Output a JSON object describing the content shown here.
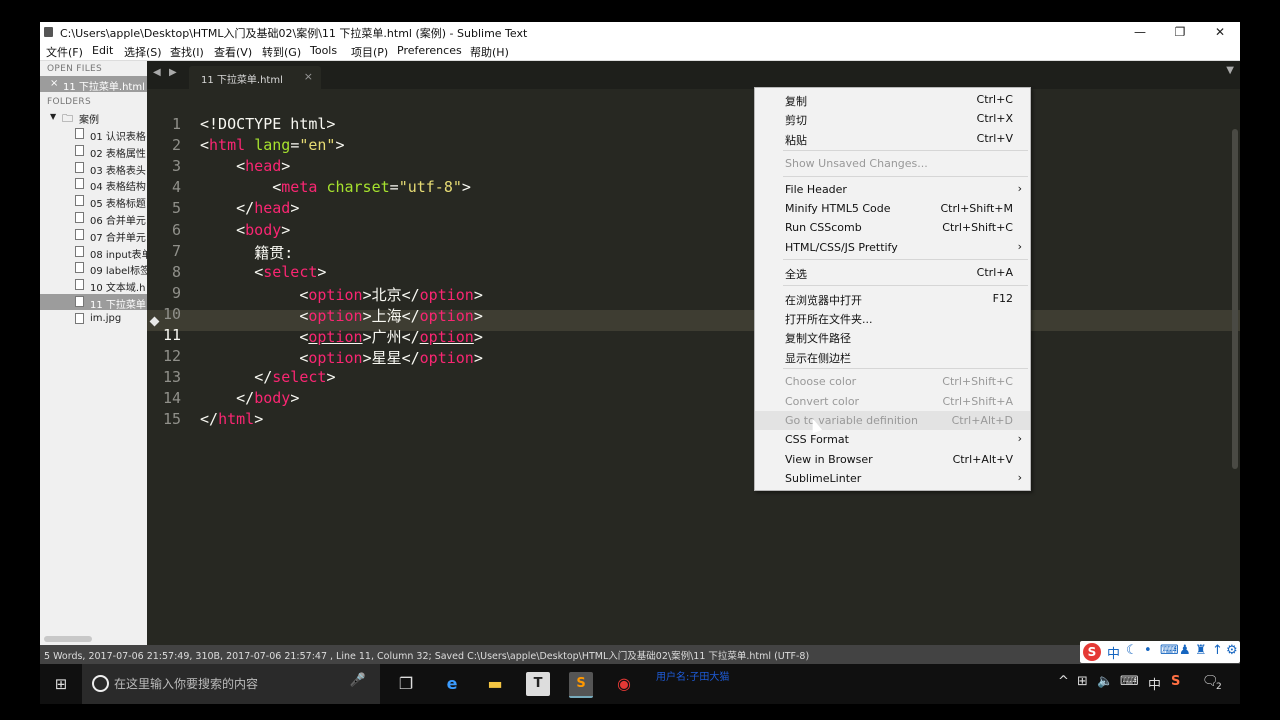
{
  "window": {
    "title": "C:\\Users\\apple\\Desktop\\HTML入门及基础02\\案例\\11 下拉菜单.html (案例) - Sublime Text",
    "controls": {
      "minimize": "—",
      "restore": "❐",
      "close": "✕"
    }
  },
  "menu": [
    "文件(F)",
    "Edit",
    "选择(S)",
    "查找(I)",
    "查看(V)",
    "转到(G)",
    "Tools",
    "项目(P)",
    "Preferences",
    "帮助(H)"
  ],
  "sidebar": {
    "open_files_label": "OPEN FILES",
    "open_file": "11 下拉菜单.html",
    "close_glyph": "×",
    "folders_label": "FOLDERS",
    "folder": "案例",
    "files": [
      "01 认识表格",
      "02 表格属性",
      "03 表格表头",
      "04 表格结构",
      "05 表格标题",
      "06 合并单元",
      "07 合并单元",
      "08 input表单",
      "09 label标签",
      "10 文本域.h",
      "11 下拉菜单",
      "im.jpg"
    ],
    "selected_index": 10
  },
  "tabs": [
    {
      "label": "11 下拉菜单.html",
      "close": "×"
    }
  ],
  "editor": {
    "active_line": 11,
    "lines": [
      {
        "n": "1",
        "indent": "",
        "parts": [
          {
            "t": "<!DOCTYPE html>",
            "c": ""
          }
        ]
      },
      {
        "n": "2",
        "indent": "",
        "parts": [
          {
            "t": "<",
            "c": ""
          },
          {
            "t": "html",
            "c": "tg"
          },
          {
            "t": " ",
            "c": ""
          },
          {
            "t": "lang",
            "c": "at"
          },
          {
            "t": "=",
            "c": ""
          },
          {
            "t": "\"en\"",
            "c": "st"
          },
          {
            "t": ">",
            "c": ""
          }
        ]
      },
      {
        "n": "3",
        "indent": "    ",
        "parts": [
          {
            "t": "<",
            "c": ""
          },
          {
            "t": "head",
            "c": "tg"
          },
          {
            "t": ">",
            "c": ""
          }
        ]
      },
      {
        "n": "4",
        "indent": "        ",
        "parts": [
          {
            "t": "<",
            "c": ""
          },
          {
            "t": "meta",
            "c": "tg"
          },
          {
            "t": " ",
            "c": ""
          },
          {
            "t": "charset",
            "c": "at"
          },
          {
            "t": "=",
            "c": ""
          },
          {
            "t": "\"utf-8\"",
            "c": "st"
          },
          {
            "t": ">",
            "c": ""
          }
        ]
      },
      {
        "n": "5",
        "indent": "    ",
        "parts": [
          {
            "t": "</",
            "c": ""
          },
          {
            "t": "head",
            "c": "tg"
          },
          {
            "t": ">",
            "c": ""
          }
        ]
      },
      {
        "n": "6",
        "indent": "    ",
        "parts": [
          {
            "t": "<",
            "c": ""
          },
          {
            "t": "body",
            "c": "tg"
          },
          {
            "t": ">",
            "c": ""
          }
        ]
      },
      {
        "n": "7",
        "indent": "      ",
        "parts": [
          {
            "t": "籍贯:",
            "c": ""
          }
        ]
      },
      {
        "n": "8",
        "indent": "      ",
        "parts": [
          {
            "t": "<",
            "c": ""
          },
          {
            "t": "select",
            "c": "tg"
          },
          {
            "t": ">",
            "c": ""
          }
        ]
      },
      {
        "n": "9",
        "indent": "           ",
        "parts": [
          {
            "t": "<",
            "c": ""
          },
          {
            "t": "option",
            "c": "tg"
          },
          {
            "t": ">北京</",
            "c": ""
          },
          {
            "t": "option",
            "c": "tg"
          },
          {
            "t": ">",
            "c": ""
          }
        ]
      },
      {
        "n": "10",
        "indent": "           ",
        "parts": [
          {
            "t": "<",
            "c": ""
          },
          {
            "t": "option",
            "c": "tg"
          },
          {
            "t": ">上海</",
            "c": ""
          },
          {
            "t": "option",
            "c": "tg"
          },
          {
            "t": ">",
            "c": ""
          }
        ]
      },
      {
        "n": "11",
        "indent": "           ",
        "parts": [
          {
            "t": "<",
            "c": ""
          },
          {
            "t": "option",
            "c": "tg ul"
          },
          {
            "t": ">广州</",
            "c": ""
          },
          {
            "t": "option",
            "c": "tg ul"
          },
          {
            "t": ">",
            "c": ""
          }
        ]
      },
      {
        "n": "12",
        "indent": "           ",
        "parts": [
          {
            "t": "<",
            "c": ""
          },
          {
            "t": "option",
            "c": "tg"
          },
          {
            "t": ">星星</",
            "c": ""
          },
          {
            "t": "option",
            "c": "tg"
          },
          {
            "t": ">",
            "c": ""
          }
        ]
      },
      {
        "n": "13",
        "indent": "      ",
        "parts": [
          {
            "t": "</",
            "c": ""
          },
          {
            "t": "select",
            "c": "tg"
          },
          {
            "t": ">",
            "c": ""
          }
        ]
      },
      {
        "n": "14",
        "indent": "    ",
        "parts": [
          {
            "t": "</",
            "c": ""
          },
          {
            "t": "body",
            "c": "tg"
          },
          {
            "t": ">",
            "c": ""
          }
        ]
      },
      {
        "n": "15",
        "indent": "",
        "parts": [
          {
            "t": "</",
            "c": ""
          },
          {
            "t": "html",
            "c": "tg"
          },
          {
            "t": ">",
            "c": ""
          }
        ]
      }
    ]
  },
  "context_menu": {
    "items": [
      {
        "label": "复制",
        "shortcut": "Ctrl+C"
      },
      {
        "label": "剪切",
        "shortcut": "Ctrl+X"
      },
      {
        "label": "粘贴",
        "shortcut": "Ctrl+V"
      },
      {
        "sep": true
      },
      {
        "label": "Show Unsaved Changes...",
        "shortcut": "",
        "disabled": true
      },
      {
        "sep": true
      },
      {
        "label": "File Header",
        "shortcut": "",
        "submenu": true
      },
      {
        "label": "Minify HTML5 Code",
        "shortcut": "Ctrl+Shift+M"
      },
      {
        "label": "Run CSScomb",
        "shortcut": "Ctrl+Shift+C"
      },
      {
        "label": "HTML/CSS/JS Prettify",
        "shortcut": "",
        "submenu": true
      },
      {
        "sep": true
      },
      {
        "label": "全选",
        "shortcut": "Ctrl+A"
      },
      {
        "sep": true
      },
      {
        "label": "在浏览器中打开",
        "shortcut": "F12"
      },
      {
        "label": "打开所在文件夹...",
        "shortcut": ""
      },
      {
        "label": "复制文件路径",
        "shortcut": ""
      },
      {
        "label": "显示在侧边栏",
        "shortcut": ""
      },
      {
        "sep": true
      },
      {
        "label": "Choose color",
        "shortcut": "Ctrl+Shift+C",
        "disabled": true
      },
      {
        "label": "Convert color",
        "shortcut": "Ctrl+Shift+A",
        "disabled": true
      },
      {
        "label": "Go to variable definition",
        "shortcut": "Ctrl+Alt+D",
        "disabled": true,
        "highlight": true
      },
      {
        "label": "CSS Format",
        "shortcut": "",
        "submenu": true
      },
      {
        "label": "View in Browser",
        "shortcut": "Ctrl+Alt+V"
      },
      {
        "label": "SublimeLinter",
        "shortcut": "",
        "submenu": true
      }
    ]
  },
  "statusbar": "5 Words, 2017-07-06 21:57:49, 310B, 2017-07-06 21:57:47 , Line 11, Column 32; Saved C:\\Users\\apple\\Desktop\\HTML入门及基础02\\案例\\11 下拉菜单.html (UTF-8)",
  "ime": [
    "S",
    "中",
    "☾",
    "•",
    "⌨",
    "♟",
    "♜",
    "↑",
    "⚙"
  ],
  "taskbar": {
    "search_placeholder": "在这里输入你要搜索的内容",
    "username_overlay": "用户名:子田大猫",
    "tray": [
      "^",
      "⊞",
      "🔈",
      "⌨",
      "中",
      "S",
      "🗨"
    ],
    "notification_count": "2"
  },
  "colors": {
    "editor_bg": "#272822",
    "tag": "#f92672",
    "attr": "#a6e22e",
    "string": "#e6db74"
  }
}
